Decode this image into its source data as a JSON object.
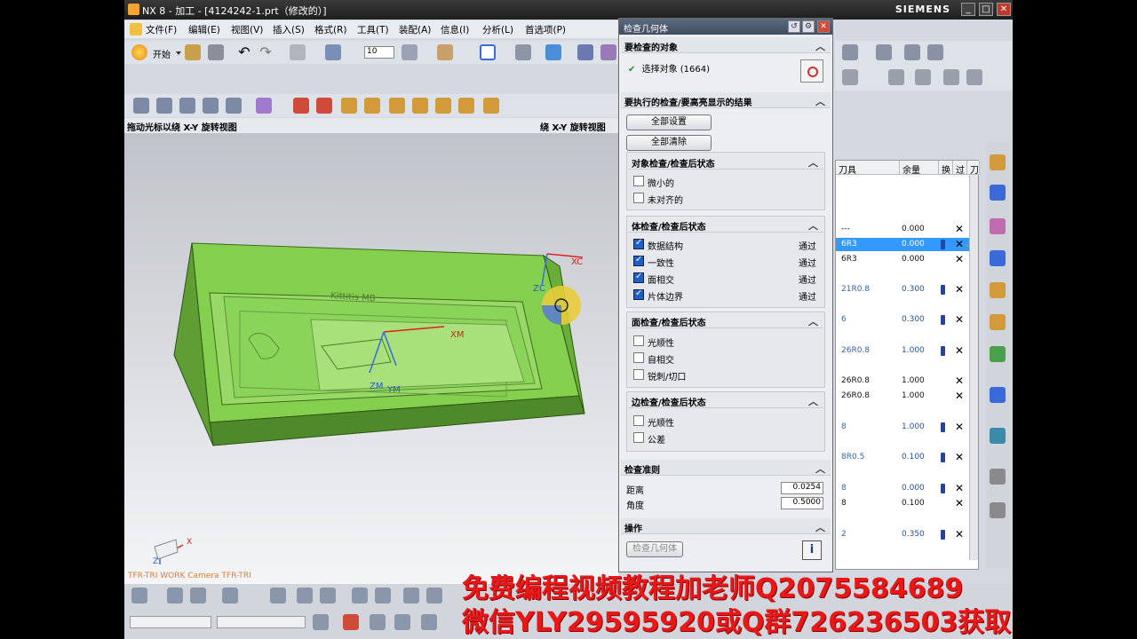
{
  "window": {
    "title": "NX 8 - 加工 - [4124242-1.prt（修改的）]",
    "brand": "SIEMENS"
  },
  "menu": [
    "文件(F)",
    "编辑(E)",
    "视图(V)",
    "插入(S)",
    "格式(R)",
    "工具(T)",
    "装配(A)",
    "信息(I)",
    "分析(L)",
    "首选项(P)"
  ],
  "toolbar": {
    "start_label": "开始",
    "size_value": "10"
  },
  "status": {
    "left": "拖动光标以绕 X-Y 旋转视图",
    "right": "绕 X-Y 旋转视图"
  },
  "viewport": {
    "labels": {
      "xc": "XC",
      "zc": "ZC",
      "xm": "XM",
      "ym": "YM",
      "zm": "ZM",
      "triad_x": "X",
      "triad_z": "Z"
    },
    "camera_label": "TFR-TRI WORK Camera TFR-TRI"
  },
  "dialog": {
    "title": "检查几何体",
    "sections": {
      "objects": "要检查的对象",
      "checks": "要执行的检查/要高亮显示的结果",
      "criteria": "检查准则",
      "operation": "操作"
    },
    "select_label": "选择对象 (1664)",
    "buttons": {
      "set_all": "全部设置",
      "clear_all": "全部清除",
      "check": "检查几何体"
    },
    "groups": {
      "object_check": {
        "title": "对象检查/检查后状态",
        "items": [
          {
            "label": "微小的",
            "checked": false,
            "status": ""
          },
          {
            "label": "未对齐的",
            "checked": false,
            "status": ""
          }
        ]
      },
      "body_check": {
        "title": "体检查/检查后状态",
        "items": [
          {
            "label": "数据结构",
            "checked": true,
            "status": "通过"
          },
          {
            "label": "一致性",
            "checked": true,
            "status": "通过"
          },
          {
            "label": "面相交",
            "checked": true,
            "status": "通过"
          },
          {
            "label": "片体边界",
            "checked": true,
            "status": "通过"
          }
        ]
      },
      "face_check": {
        "title": "面检查/检查后状态",
        "items": [
          {
            "label": "光顺性",
            "checked": false,
            "status": ""
          },
          {
            "label": "自相交",
            "checked": false,
            "status": ""
          },
          {
            "label": "锐刺/切口",
            "checked": false,
            "status": ""
          }
        ]
      },
      "edge_check": {
        "title": "边检查/检查后状态",
        "items": [
          {
            "label": "光顺性",
            "checked": false,
            "status": ""
          },
          {
            "label": "公差",
            "checked": false,
            "status": ""
          }
        ]
      }
    },
    "criteria": {
      "distance_label": "距离",
      "distance_value": "0.0254",
      "angle_label": "角度",
      "angle_value": "0.5000"
    }
  },
  "table": {
    "headers": [
      "刀具",
      "余量",
      "换",
      "过",
      "刀"
    ],
    "rows": [
      {
        "tool": "---",
        "rem": "0.000",
        "marker": false,
        "selected": false,
        "warn": false
      },
      {
        "tool": "6R3",
        "rem": "0.000",
        "marker": true,
        "selected": true,
        "warn": true
      },
      {
        "tool": "6R3",
        "rem": "0.000",
        "marker": false,
        "selected": false,
        "warn": false
      },
      {
        "tool": "21R0.8",
        "rem": "0.300",
        "marker": true,
        "selected": false,
        "warn": false
      },
      {
        "tool": "6",
        "rem": "0.300",
        "marker": true,
        "selected": false,
        "warn": false
      },
      {
        "tool": "26R0.8",
        "rem": "1.000",
        "marker": true,
        "selected": false,
        "warn": false
      },
      {
        "tool": "26R0.8",
        "rem": "1.000",
        "marker": false,
        "selected": false,
        "warn": false
      },
      {
        "tool": "26R0.8",
        "rem": "1.000",
        "marker": false,
        "selected": false,
        "warn": false
      },
      {
        "tool": "8",
        "rem": "1.000",
        "marker": true,
        "selected": false,
        "warn": false
      },
      {
        "tool": "8R0.5",
        "rem": "0.100",
        "marker": true,
        "selected": false,
        "warn": false
      },
      {
        "tool": "8",
        "rem": "0.000",
        "marker": true,
        "selected": false,
        "warn": false
      },
      {
        "tool": "8",
        "rem": "0.100",
        "marker": false,
        "selected": false,
        "warn": false
      },
      {
        "tool": "2",
        "rem": "0.350",
        "marker": true,
        "selected": false,
        "warn": false
      }
    ]
  },
  "watermark": {
    "line1": "免费编程视频教程加老师Q2075584689",
    "line2": "微信YLY29595920或Q群726236503获取"
  },
  "colors": {
    "model_green": "#7ccc44",
    "selection_blue": "#3399ff",
    "watermark_red": "#e81818"
  }
}
